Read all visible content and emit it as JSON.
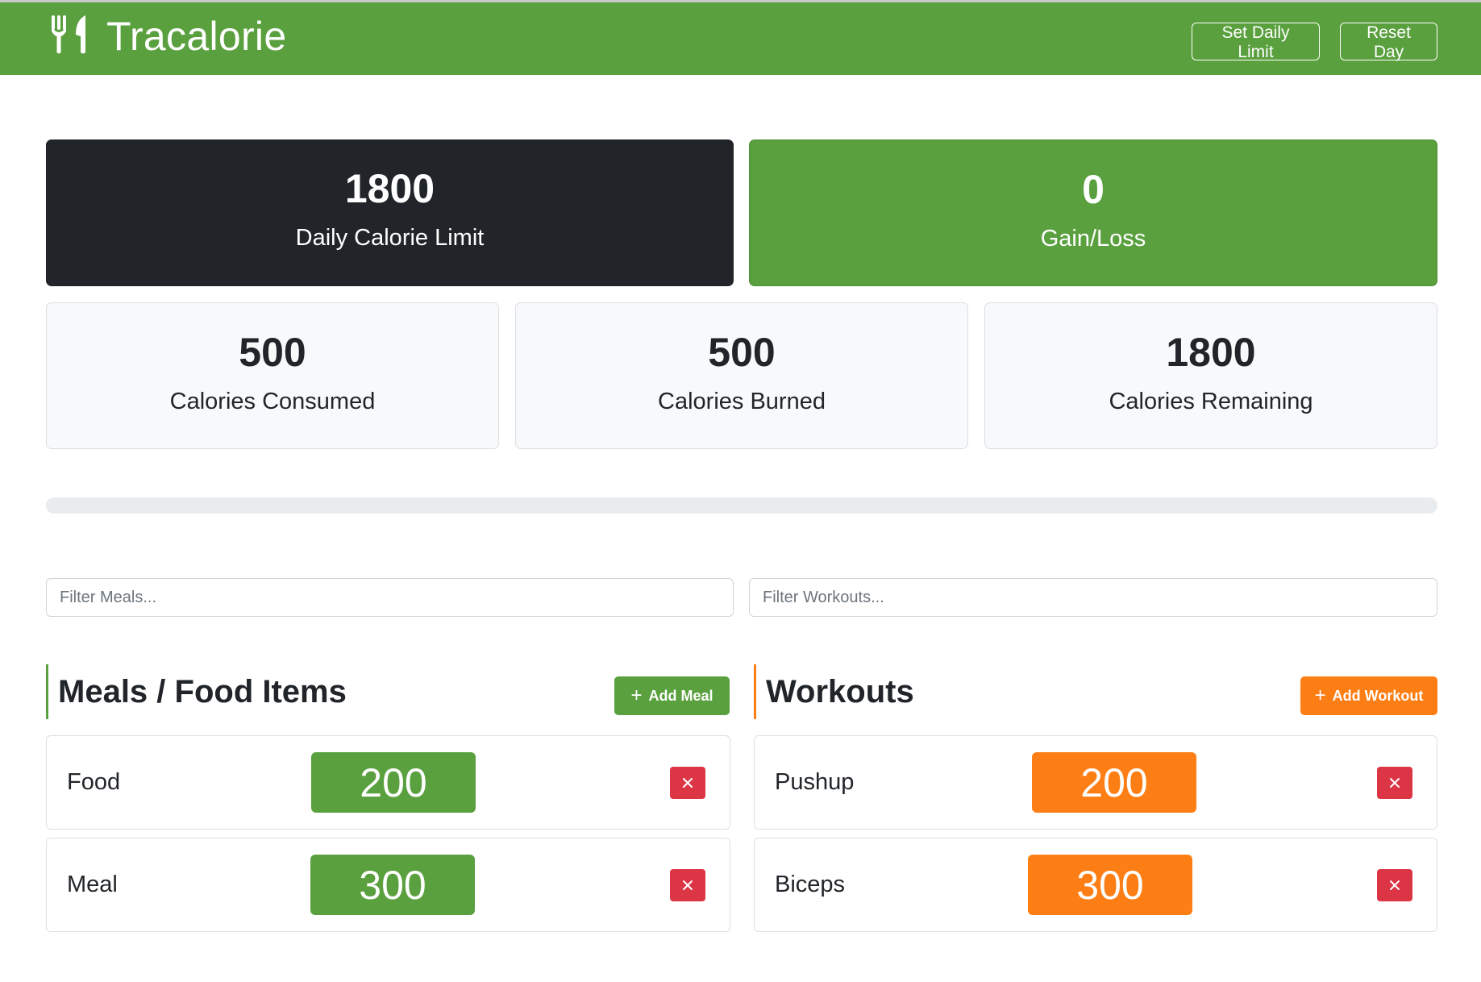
{
  "navbar": {
    "brand": "Tracalorie",
    "brand_icon": "utensils-icon",
    "set_limit_label": "Set Daily Limit",
    "reset_label": "Reset Day"
  },
  "stats": {
    "limit": {
      "value": "1800",
      "label": "Daily Calorie Limit"
    },
    "gain_loss": {
      "value": "0",
      "label": "Gain/Loss"
    },
    "consumed": {
      "value": "500",
      "label": "Calories Consumed"
    },
    "burned": {
      "value": "500",
      "label": "Calories Burned"
    },
    "remaining": {
      "value": "1800",
      "label": "Calories Remaining"
    }
  },
  "progress": {
    "percent": 0
  },
  "filters": {
    "meals_placeholder": "Filter Meals...",
    "workouts_placeholder": "Filter Workouts..."
  },
  "meals": {
    "title": "Meals / Food Items",
    "add_label": "Add Meal",
    "items": [
      {
        "name": "Food",
        "calories": "200"
      },
      {
        "name": "Meal",
        "calories": "300"
      }
    ]
  },
  "workouts": {
    "title": "Workouts",
    "add_label": "Add Workout",
    "items": [
      {
        "name": "Pushup",
        "calories": "200"
      },
      {
        "name": "Biceps",
        "calories": "300"
      }
    ]
  },
  "colors": {
    "primary_green": "#5aa03f",
    "dark": "#212529",
    "orange": "#fd7e14",
    "danger": "#dc3545"
  }
}
